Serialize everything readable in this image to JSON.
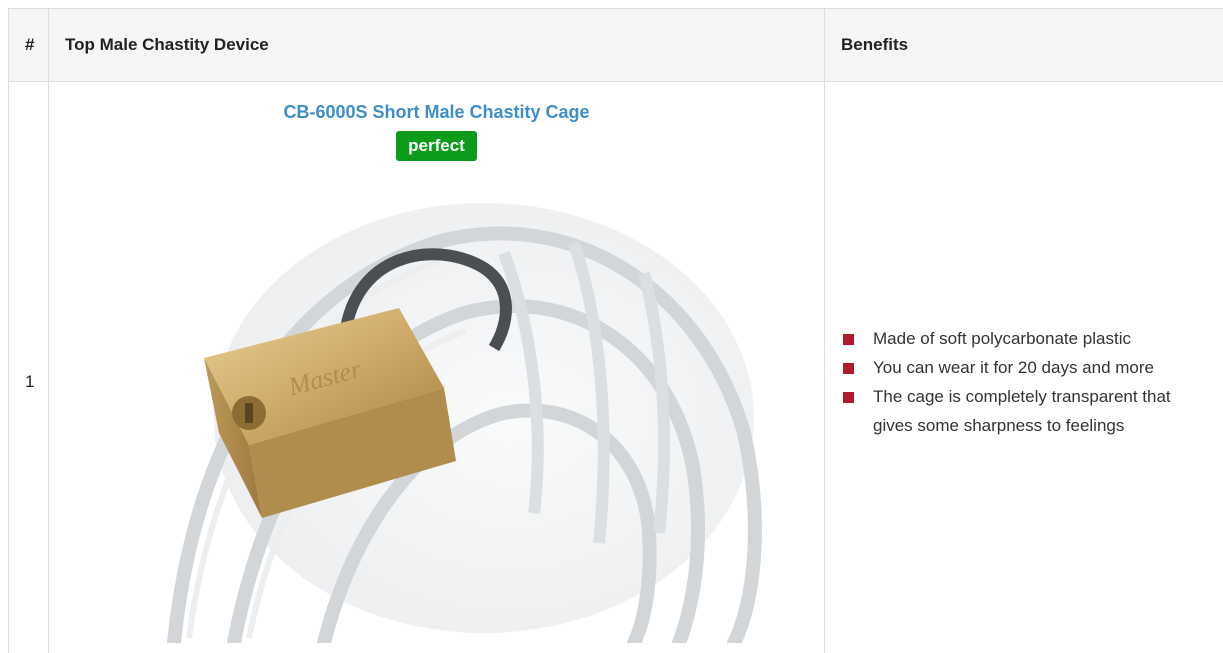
{
  "table": {
    "headers": {
      "rank": "#",
      "device": "Top Male Chastity Device",
      "benefits": "Benefits"
    },
    "rows": [
      {
        "rank": "1",
        "product_name": "CB-6000S Short Male Chastity Cage",
        "rating": "perfect",
        "padlock_engraving": "Master",
        "benefits": [
          "Made of soft polycarbonate plastic",
          "You can wear it for 20 days and more",
          "The cage is completely transparent that gives some sharpness to feelings"
        ]
      }
    ]
  },
  "colors": {
    "link": "#3d8ec9",
    "badge": "#0c9b1a",
    "bullet": "#b3182b",
    "header_bg": "#f5f6f7",
    "border": "#dddddd"
  }
}
